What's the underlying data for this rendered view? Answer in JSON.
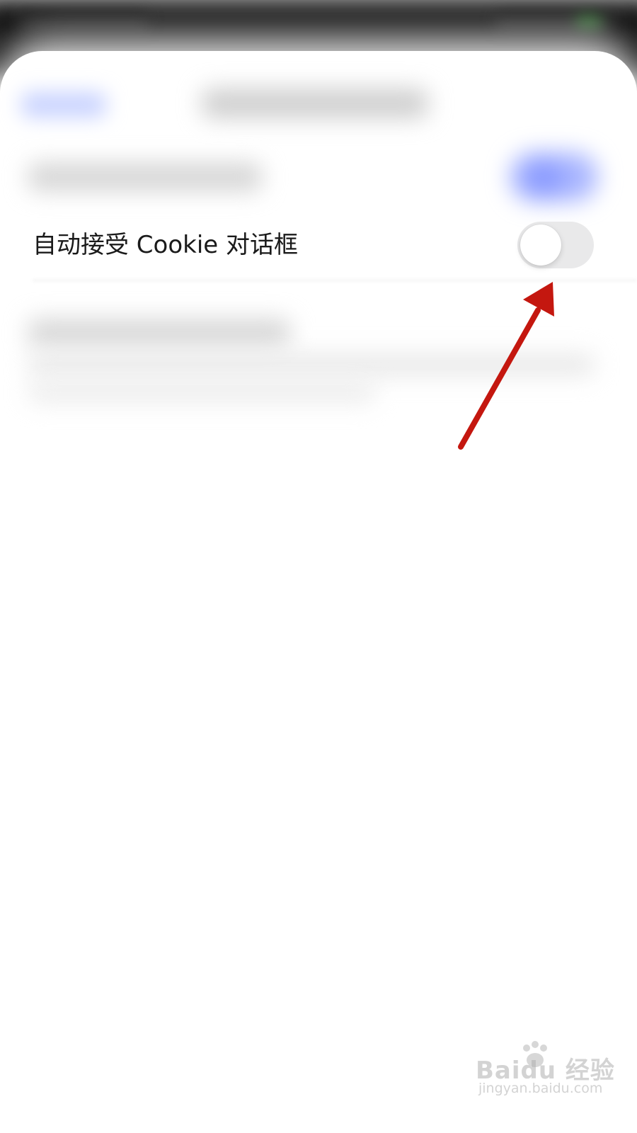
{
  "setting": {
    "label": "自动接受 Cookie 对话框",
    "toggle_on": false
  },
  "annotation": {
    "arrow_color": "#c4170f"
  },
  "watermark": {
    "brand": "Baidu 经验",
    "url": "jingyan.baidu.com"
  },
  "colors": {
    "toggle_off_track": "#e9e9ea",
    "toggle_knob": "#ffffff",
    "accent_blurred": "#a9b6ff"
  }
}
